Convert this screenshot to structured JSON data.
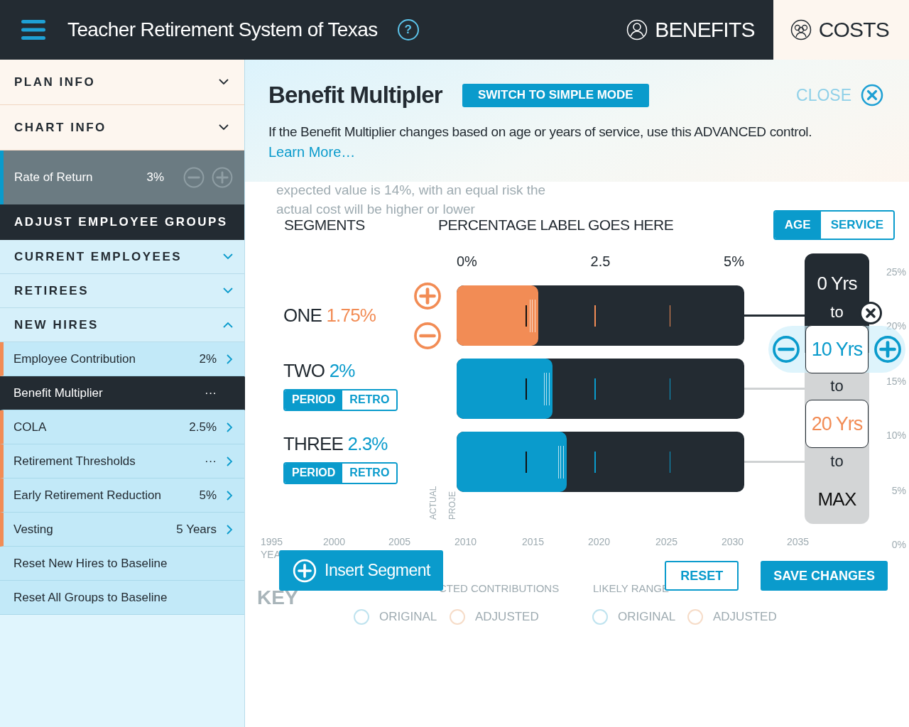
{
  "header": {
    "title": "Teacher Retirement System of Texas",
    "help_label": "?",
    "tabs": [
      {
        "label": "BENEFITS",
        "kind": "person",
        "selected": false
      },
      {
        "label": "COSTS",
        "kind": "group",
        "selected": true
      }
    ]
  },
  "sidebar": {
    "sections": [
      {
        "label": "PLAN INFO",
        "expanded": false
      },
      {
        "label": "CHART INFO",
        "expanded": false
      }
    ],
    "rate_of_return": {
      "label": "Rate of Return",
      "value": "3%"
    },
    "groups_heading": "ADJUST EMPLOYEE GROUPS",
    "groups": [
      {
        "label": "CURRENT EMPLOYEES",
        "expanded": false
      },
      {
        "label": "RETIREES",
        "expanded": false
      },
      {
        "label": "NEW HIRES",
        "expanded": true,
        "children": [
          {
            "label": "Employee Contribution",
            "value": "2%",
            "selected": false
          },
          {
            "label": "Benefit Multiplier",
            "value": "···",
            "selected": true
          },
          {
            "label": "COLA",
            "value": "2.5%",
            "selected": false
          },
          {
            "label": "Retirement Thresholds",
            "value": "···",
            "selected": false
          },
          {
            "label": "Early Retirement Reduction",
            "value": "5%",
            "selected": false
          },
          {
            "label": "Vesting",
            "value": "5 Years",
            "selected": false
          }
        ]
      }
    ],
    "actions": [
      "Reset New Hires to Baseline",
      "Reset All Groups to Baseline"
    ]
  },
  "background_chart": {
    "note": [
      "expected value is 14%, with an equal risk the",
      "actual cost will be higher or lower"
    ],
    "years": [
      "1995",
      "2000",
      "2005",
      "2010",
      "2015",
      "2020",
      "2025",
      "2030",
      "2035"
    ],
    "year_axis_label": "YEA",
    "y_ticks": [
      "25%",
      "20%",
      "15%",
      "10%",
      "5%",
      "0%"
    ],
    "vertical_labels": [
      "ACTUAL",
      "PROJE"
    ],
    "key_label": "KEY",
    "legend_headings": [
      "CTED CONTRIBUTIONS",
      "LIKELY RANGE"
    ],
    "legend": [
      {
        "label": "ORIGINAL",
        "color": "#bfe3ef"
      },
      {
        "label": "ADJUSTED",
        "color": "#f6dcc8"
      },
      {
        "label": "ORIGINAL",
        "color": "#bfe3ef"
      },
      {
        "label": "ADJUSTED",
        "color": "#f6dcc8"
      }
    ]
  },
  "modal": {
    "title": "Benefit Multipler",
    "mode_button": "SWITCH TO SIMPLE MODE",
    "close_label": "CLOSE",
    "description": "If the Benefit Multiplier changes based on age or years of service, use this ADVANCED control.",
    "link": "Learn More…",
    "segments_heading": "SEGMENTS",
    "percentage_heading": "PERCENTAGE LABEL GOES HERE",
    "basis": [
      {
        "label": "AGE",
        "selected": true
      },
      {
        "label": "SERVICE",
        "selected": false
      }
    ],
    "scale": [
      "0%",
      "2.5",
      "5%"
    ],
    "segments": [
      {
        "name": "ONE",
        "value": "1.75%",
        "level": 0.284,
        "selected": true
      },
      {
        "name": "TWO",
        "value": "2%",
        "level": 0.333,
        "selected": false,
        "modes": [
          {
            "label": "PERIOD",
            "selected": true
          },
          {
            "label": "RETRO",
            "selected": false
          }
        ]
      },
      {
        "name": "THREE",
        "value": "2.3%",
        "level": 0.383,
        "selected": false,
        "modes": [
          {
            "label": "PERIOD",
            "selected": true
          },
          {
            "label": "RETRO",
            "selected": false
          }
        ]
      }
    ],
    "ranges": [
      {
        "label": "0 Yrs",
        "kind": "fixed"
      },
      {
        "label": "to",
        "kind": "separator"
      },
      {
        "label": "10 Yrs",
        "kind": "editable",
        "selected": true
      },
      {
        "label": "to",
        "kind": "separator"
      },
      {
        "label": "20 Yrs",
        "kind": "editable",
        "selected": false
      },
      {
        "label": "to",
        "kind": "separator"
      },
      {
        "label": "MAX",
        "kind": "fixed"
      }
    ],
    "insert_button": "Insert Segment",
    "reset_button": "RESET",
    "save_button": "SAVE CHANGES"
  }
}
